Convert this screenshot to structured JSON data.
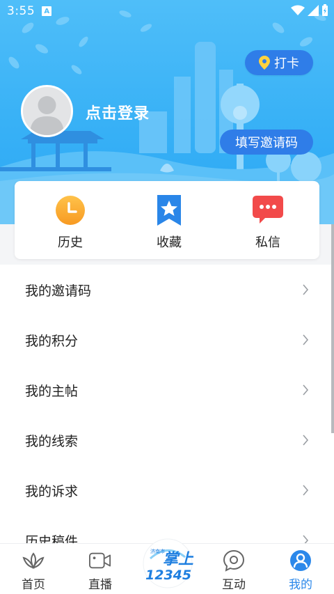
{
  "status_bar": {
    "time": "3:55",
    "indicator": "A"
  },
  "header": {
    "checkin_label": "打卡",
    "login_label": "点击登录",
    "invite_label": "填写邀请码"
  },
  "quick_actions": [
    {
      "label": "历史",
      "icon": "clock-icon"
    },
    {
      "label": "收藏",
      "icon": "bookmark-star-icon"
    },
    {
      "label": "私信",
      "icon": "message-icon"
    }
  ],
  "menu": [
    "我的邀请码",
    "我的积分",
    "我的主帖",
    "我的线索",
    "我的诉求",
    "历史稿件"
  ],
  "tabs": [
    {
      "label": "首页",
      "icon": "lotus-home-icon"
    },
    {
      "label": "直播",
      "icon": "video-camera-icon"
    },
    {
      "label": "",
      "icon": "center-logo"
    },
    {
      "label": "互动",
      "icon": "chat-icon"
    },
    {
      "label": "我的",
      "icon": "user-icon",
      "active": true
    }
  ],
  "logo": {
    "text_top": "掌上",
    "text_bottom": "12345",
    "text_side": "济南市"
  },
  "colors": {
    "brand_blue": "#2f7de8",
    "header_blue": "#38b1f6",
    "active_tab": "#2b88ea",
    "history_orange": "#f7a22c",
    "favorite_blue": "#2a86e8",
    "message_red": "#f24a4a"
  }
}
